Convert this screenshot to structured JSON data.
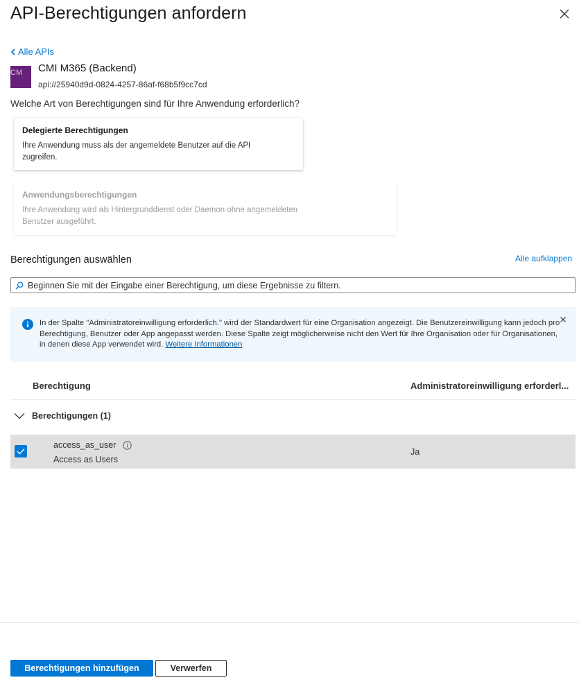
{
  "panel": {
    "title": "API-Berechtigungen anfordern",
    "close_icon": "close-icon",
    "back_link": "Alle APIs"
  },
  "api": {
    "logo_text": "CM",
    "name": "CMI M365 (Backend)",
    "uri": "api://25940d9d-0824-4257-86af-f68b5f9cc7cd",
    "logo_color": "#68217a"
  },
  "permission_type": {
    "question": "Welche Art von Berechtigungen sind für Ihre Anwendung erforderlich?",
    "delegated": {
      "title": "Delegierte Berechtigungen",
      "description": "Ihre Anwendung muss als der angemeldete Benutzer auf die API zugreifen."
    },
    "application": {
      "title": "Anwendungsberechtigungen",
      "description": "Ihre Anwendung wird als Hintergrunddienst oder Daemon ohne angemeldeten Benutzer ausgeführt."
    }
  },
  "select": {
    "title": "Berechtigungen auswählen",
    "expand_all": "Alle aufklappen",
    "search_placeholder": "Beginnen Sie mit der Eingabe einer Berechtigung, um diese Ergebnisse zu filtern."
  },
  "info": {
    "text": "In der Spalte \"Administratoreinwilligung erforderlich.\" wird der Standardwert für eine Organisation angezeigt. Die Benutzereinwilligung kann jedoch pro Berechtigung, Benutzer oder App angepasst werden. Diese Spalte zeigt möglicherweise nicht den Wert für Ihre Organisation oder für Organisationen, in denen diese App verwendet wird.",
    "link": "Weitere Informationen"
  },
  "table": {
    "headers": {
      "permission": "Berechtigung",
      "admin_consent": "Administratoreinwilligung erforderl..."
    },
    "group_label": "Berechtigungen (1)",
    "rows": [
      {
        "name": "access_as_user",
        "description": "Access as Users",
        "admin_consent": "Ja",
        "checked": true
      }
    ]
  },
  "footer": {
    "add_button": "Berechtigungen hinzufügen",
    "discard_button": "Verwerfen"
  },
  "colors": {
    "accent": "#0078d4",
    "info_bg": "#eff6fc",
    "selected_row": "#e1dfdd"
  }
}
